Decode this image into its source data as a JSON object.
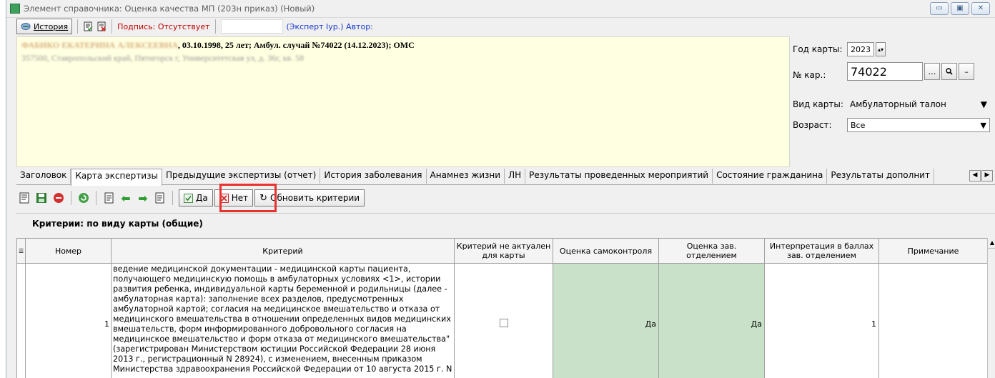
{
  "window": {
    "title": "Элемент справочника: Оценка качества МП (203н приказ) (Новый)",
    "controls": [
      "▭",
      "▣",
      "✕"
    ]
  },
  "toolbar": {
    "history_label": "История",
    "signature_label": "Подпись: Отсутствует",
    "expert_label": "(Эксперт Iур.) Автор:"
  },
  "patient": {
    "line1_blurred": "ФАБИКО ЕКАТЕРИНА АЛЕКСЕЕВНА",
    "line1_visible": ", 03.10.1998, 25 лет; Амбул. случай №74022 (14.12.2023); ОМС",
    "line2": "357500, Ставропольский край, Пятигорск г, Университетская ул, д. 36г, кв. 58"
  },
  "card": {
    "year_label": "Год карты:",
    "year_value": "2023",
    "num_label": "№ кар.:",
    "num_value": "74022",
    "type_label": "Вид карты:",
    "type_value": "Амбулаторный талон",
    "age_label": "Возраст:",
    "age_value": "Все"
  },
  "tabs": [
    "Заголовок",
    "Карта экспертизы",
    "Предыдущие экспертизы (отчет)",
    "История заболевания",
    "Анамнез жизни",
    "ЛН",
    "Результаты проведенных мероприятий",
    "Состояние гражданина",
    "Результаты дополнит"
  ],
  "action_bar": {
    "yes_label": "Да",
    "no_label": "Нет",
    "refresh_label": "Обновить критерии"
  },
  "criteria_title": "Критерии: по виду карты (общие)",
  "table": {
    "columns": [
      "Номер",
      "Критерий",
      "Критерий не актуален для карты",
      "Оценка самоконтроля",
      "Оценка зав. отделением",
      "Интерпретация в баллах зав. отделением",
      "Примечание"
    ],
    "rows": [
      {
        "number": "1",
        "criterion": "ведение медицинской документации - медицинской карты пациента, получающего медицинскую помощь в амбулаторных условиях <1>, истории развития ребенка, индивидуальной карты беременной и родильницы (далее - амбулаторная карта): заполнение всех разделов, предусмотренных амбулаторной картой; согласия на медицинское вмешательство и отказа от медицинского вмешательства в отношении определенных видов медицинских вмешательств, форм информированного добровольного согласия на медицинское вмешательство и форм отказа от медицинского вмешательства\" (зарегистрирован Министерством юстиции Российской Федерации 28 июня 2013 г., регистрационный N 28924), с изменением, внесенным приказом Министерства здравоохранения Российской Федерации от 10 августа 2015 г. N",
        "self_score": "Да",
        "head_score": "Да",
        "points": "1",
        "note": ""
      }
    ]
  }
}
